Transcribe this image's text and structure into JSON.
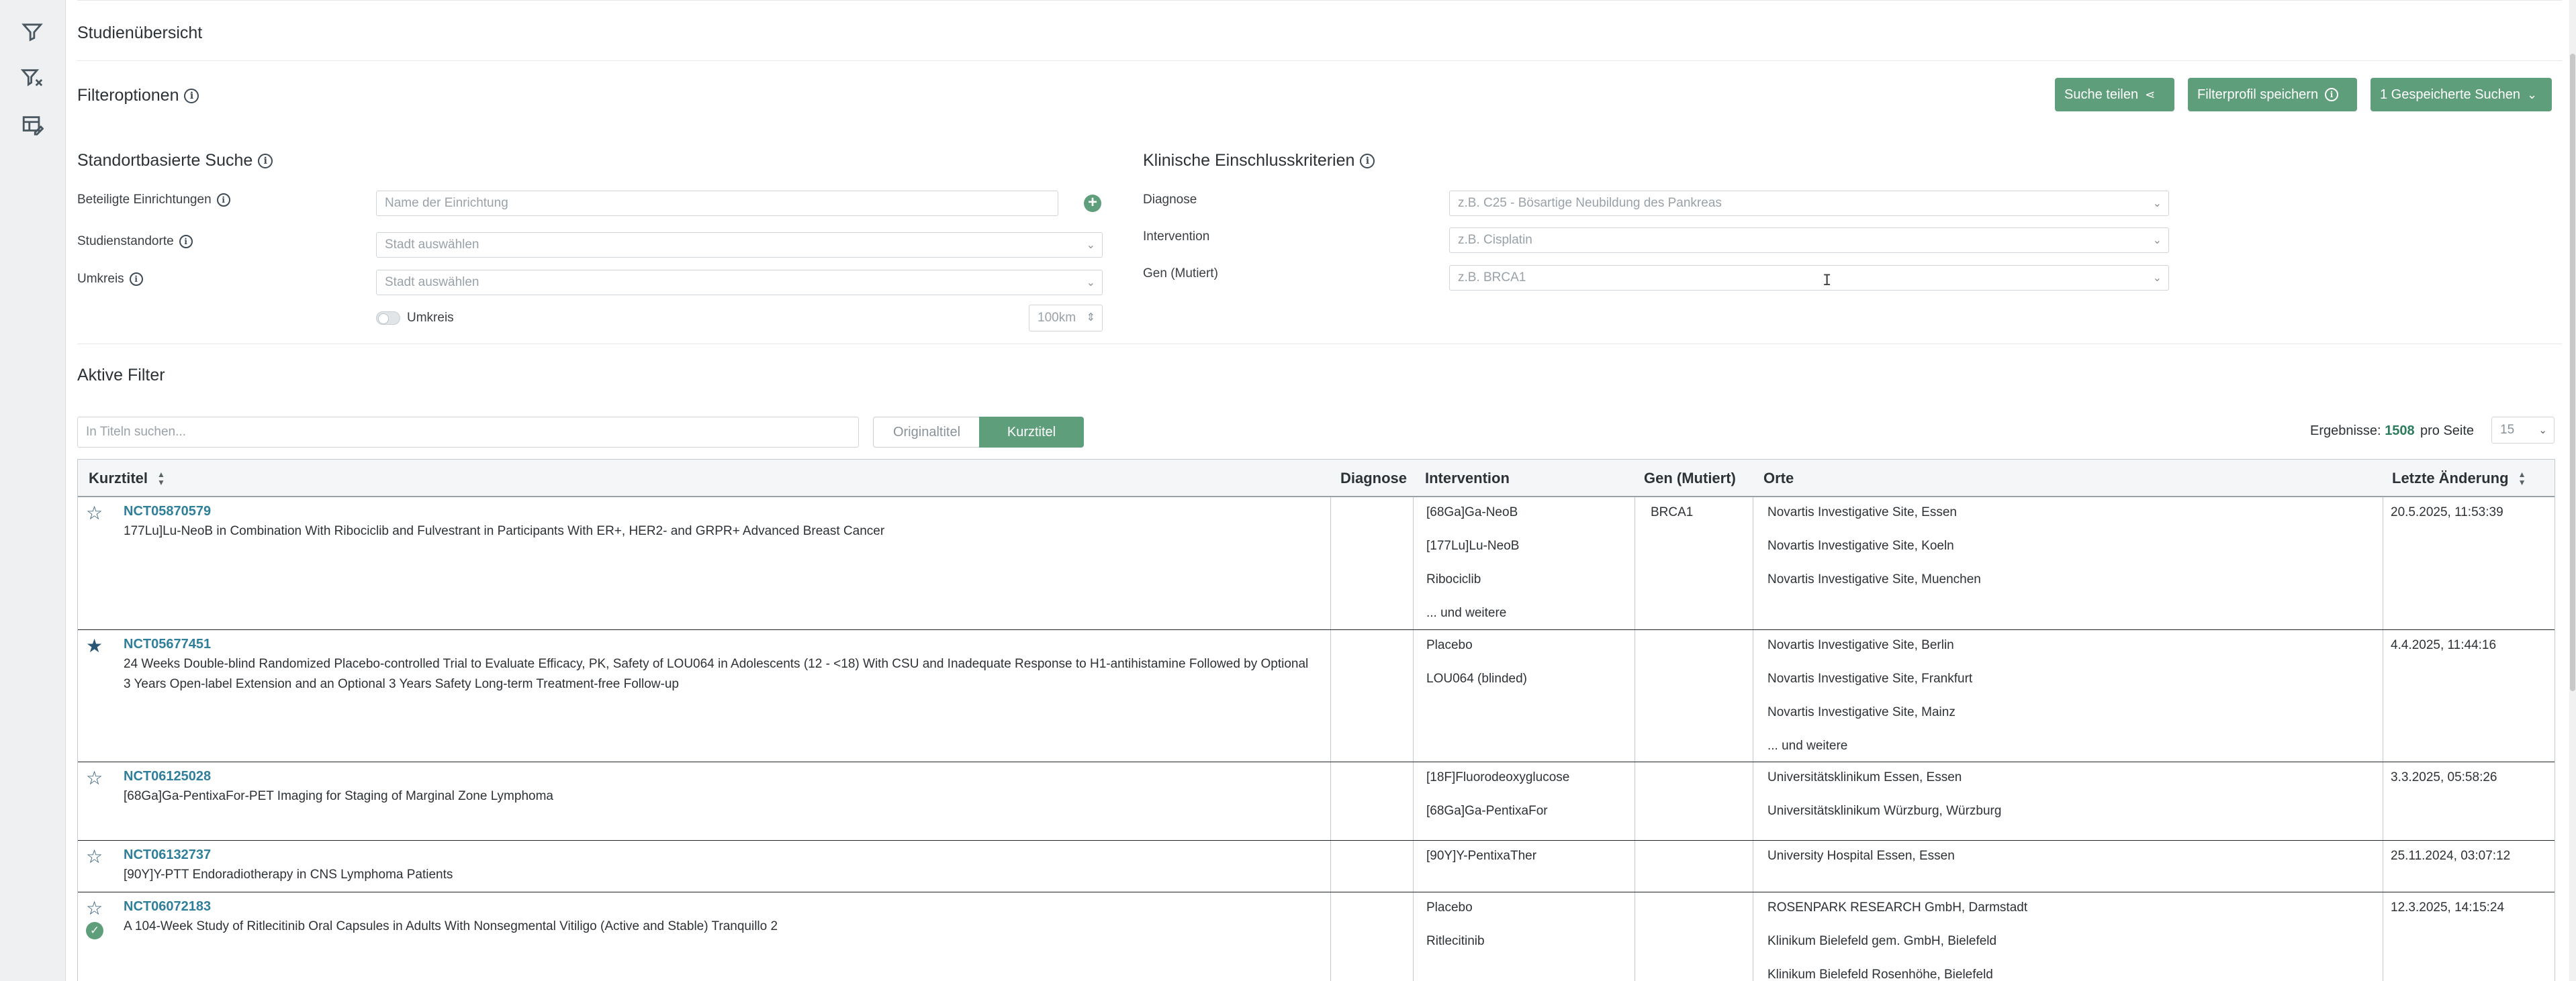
{
  "app": {
    "page_title": "Studienübersicht"
  },
  "sidebar": {
    "icons": [
      "filter-icon",
      "clear-filter-icon",
      "table-edit-icon"
    ]
  },
  "filter": {
    "title": "Filteroptionen",
    "buttons": {
      "share": "Suche teilen",
      "save_profile": "Filterprofil speichern",
      "saved_searches": "1 Gespeicherte Suchen"
    }
  },
  "location": {
    "title": "Standortbasierte Suche",
    "institutions_label": "Beteiligte Einrichtungen",
    "institutions_placeholder": "Name der Einrichtung",
    "sites_label": "Studienstandorte",
    "sites_placeholder": "Stadt auswählen",
    "radius_label": "Umkreis",
    "radius_placeholder": "Stadt auswählen",
    "radius_toggle_label": "Umkreis",
    "radius_value": "100km"
  },
  "clinical": {
    "title": "Klinische Einschlusskriterien",
    "diagnosis_label": "Diagnose",
    "diagnosis_placeholder": "z.B. C25 - Bösartige Neubildung des Pankreas",
    "intervention_label": "Intervention",
    "intervention_placeholder": "z.B. Cisplatin",
    "gene_label": "Gen (Mutiert)",
    "gene_placeholder": "z.B. BRCA1"
  },
  "active_filters": {
    "title": "Aktive Filter",
    "search_placeholder": "In Titeln suchen...",
    "toggle_original": "Originaltitel",
    "toggle_short": "Kurztitel",
    "results_label": "Ergebnisse:",
    "results_count": "1508",
    "per_page_label": "pro Seite",
    "per_page_value": "15"
  },
  "table": {
    "headers": {
      "short_title": "Kurztitel",
      "diagnosis": "Diagnose",
      "intervention": "Intervention",
      "gene": "Gen (Mutiert)",
      "locations": "Orte",
      "last_change": "Letzte Änderung"
    },
    "rows": [
      {
        "id": "NCT05870579",
        "title": "177Lu]Lu-NeoB in Combination With Ribociclib and Fulvestrant in Participants With ER+, HER2- and GRPR+ Advanced Breast Cancer",
        "starred": false,
        "interventions": [
          "[68Ga]Ga-NeoB",
          "[177Lu]Lu-NeoB",
          "Ribociclib",
          "... und weitere"
        ],
        "gene": "BRCA1",
        "locations": [
          "Novartis Investigative Site, Essen",
          "Novartis Investigative Site, Koeln",
          "Novartis Investigative Site, Muenchen"
        ],
        "last_change": "20.5.2025, 11:53:39"
      },
      {
        "id": "NCT05677451",
        "title": "24 Weeks Double-blind Randomized Placebo-controlled Trial to Evaluate Efficacy, PK, Safety of LOU064 in Adolescents (12 - <18) With CSU and Inadequate Response to H1-antihistamine Followed by Optional 3 Years Open-label Extension and an Optional 3 Years Safety Long-term Treatment-free Follow-up",
        "starred": true,
        "interventions": [
          "Placebo",
          "LOU064 (blinded)"
        ],
        "gene": "",
        "locations": [
          "Novartis Investigative Site, Berlin",
          "Novartis Investigative Site, Frankfurt",
          "Novartis Investigative Site, Mainz",
          "... und weitere"
        ],
        "last_change": "4.4.2025, 11:44:16"
      },
      {
        "id": "NCT06125028",
        "title": "[68Ga]Ga-PentixaFor-PET Imaging for Staging of Marginal Zone Lymphoma",
        "starred": false,
        "interventions": [
          "[18F]Fluorodeoxyglucose",
          "[68Ga]Ga-PentixaFor"
        ],
        "gene": "",
        "locations": [
          "Universitätsklinikum Essen, Essen",
          "Universitätsklinikum Würzburg, Würzburg"
        ],
        "last_change": "3.3.2025, 05:58:26"
      },
      {
        "id": "NCT06132737",
        "title": "[90Y]Y-PTT Endoradiotherapy in CNS Lymphoma Patients",
        "starred": false,
        "interventions": [
          "[90Y]Y-PentixaTher"
        ],
        "gene": "",
        "locations": [
          "University Hospital Essen, Essen"
        ],
        "last_change": "25.11.2024, 03:07:12"
      },
      {
        "id": "NCT06072183",
        "title": "A 104-Week Study of Ritlecitinib Oral Capsules in Adults With Nonsegmental Vitiligo (Active and Stable) Tranquillo 2",
        "starred": false,
        "checked": true,
        "interventions": [
          "Placebo",
          "Ritlecitinib"
        ],
        "gene": "",
        "locations": [
          "ROSENPARK RESEARCH GmbH, Darmstadt",
          "Klinikum Bielefeld gem. GmbH, Bielefeld",
          "Klinikum Bielefeld Rosenhöhe, Bielefeld"
        ],
        "last_change": "12.3.2025, 14:15:24"
      }
    ]
  }
}
